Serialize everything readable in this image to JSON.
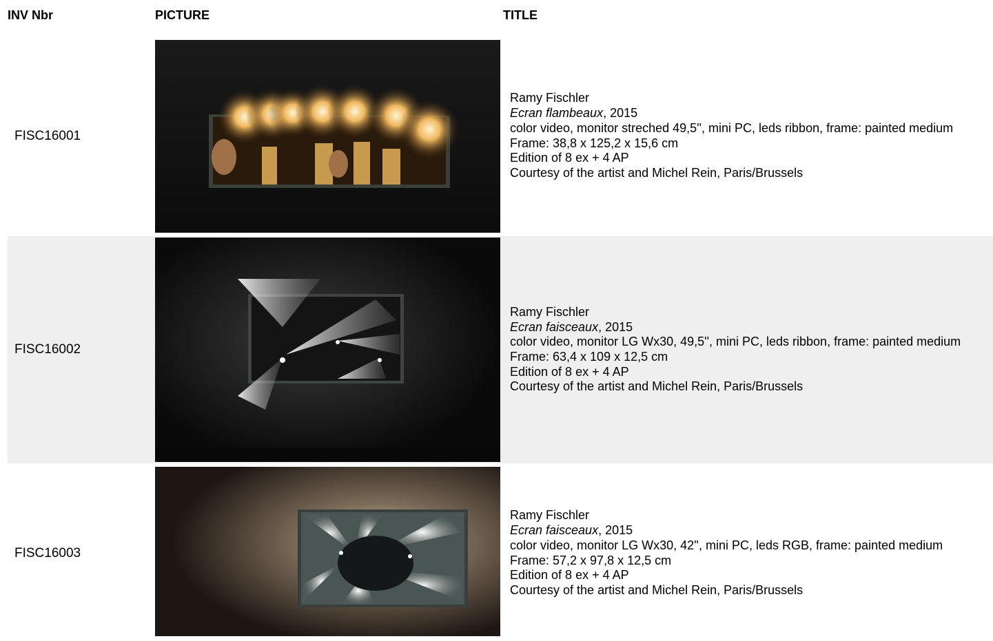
{
  "header": {
    "inv": "INV Nbr",
    "picture": "PICTURE",
    "title": "TITLE"
  },
  "rows": [
    {
      "inv": "FISC16001",
      "artist": "Ramy Fischler",
      "work": "Ecran flambeaux",
      "year": ", 2015",
      "medium": "color video, monitor streched 49,5'', mini PC, leds ribbon, frame: painted medium",
      "frame": "Frame: 38,8 x 125,2 x 15,6 cm",
      "edition": "Edition of 8 ex + 4 AP",
      "courtesy": "Courtesy of the artist and Michel Rein, Paris/Brussels"
    },
    {
      "inv": "FISC16002",
      "artist": "Ramy Fischler",
      "work": "Ecran faisceaux",
      "year": ", 2015",
      "medium": "color video, monitor LG Wx30, 49,5'', mini PC, leds ribbon, frame: painted medium",
      "frame": "Frame: 63,4 x 109 x 12,5 cm",
      "edition": "Edition of 8 ex + 4 AP",
      "courtesy": "Courtesy of the artist and Michel Rein, Paris/Brussels"
    },
    {
      "inv": "FISC16003",
      "artist": "Ramy Fischler",
      "work": "Ecran faisceaux",
      "year": ", 2015",
      "medium": "color video, monitor LG Wx30, 42'', mini PC, leds RGB, frame: painted medium",
      "frame": "Frame: 57,2 x 97,8 x 12,5 cm",
      "edition": "Edition of 8 ex + 4 AP",
      "courtesy": "Courtesy of the artist and Michel Rein, Paris/Brussels"
    }
  ]
}
